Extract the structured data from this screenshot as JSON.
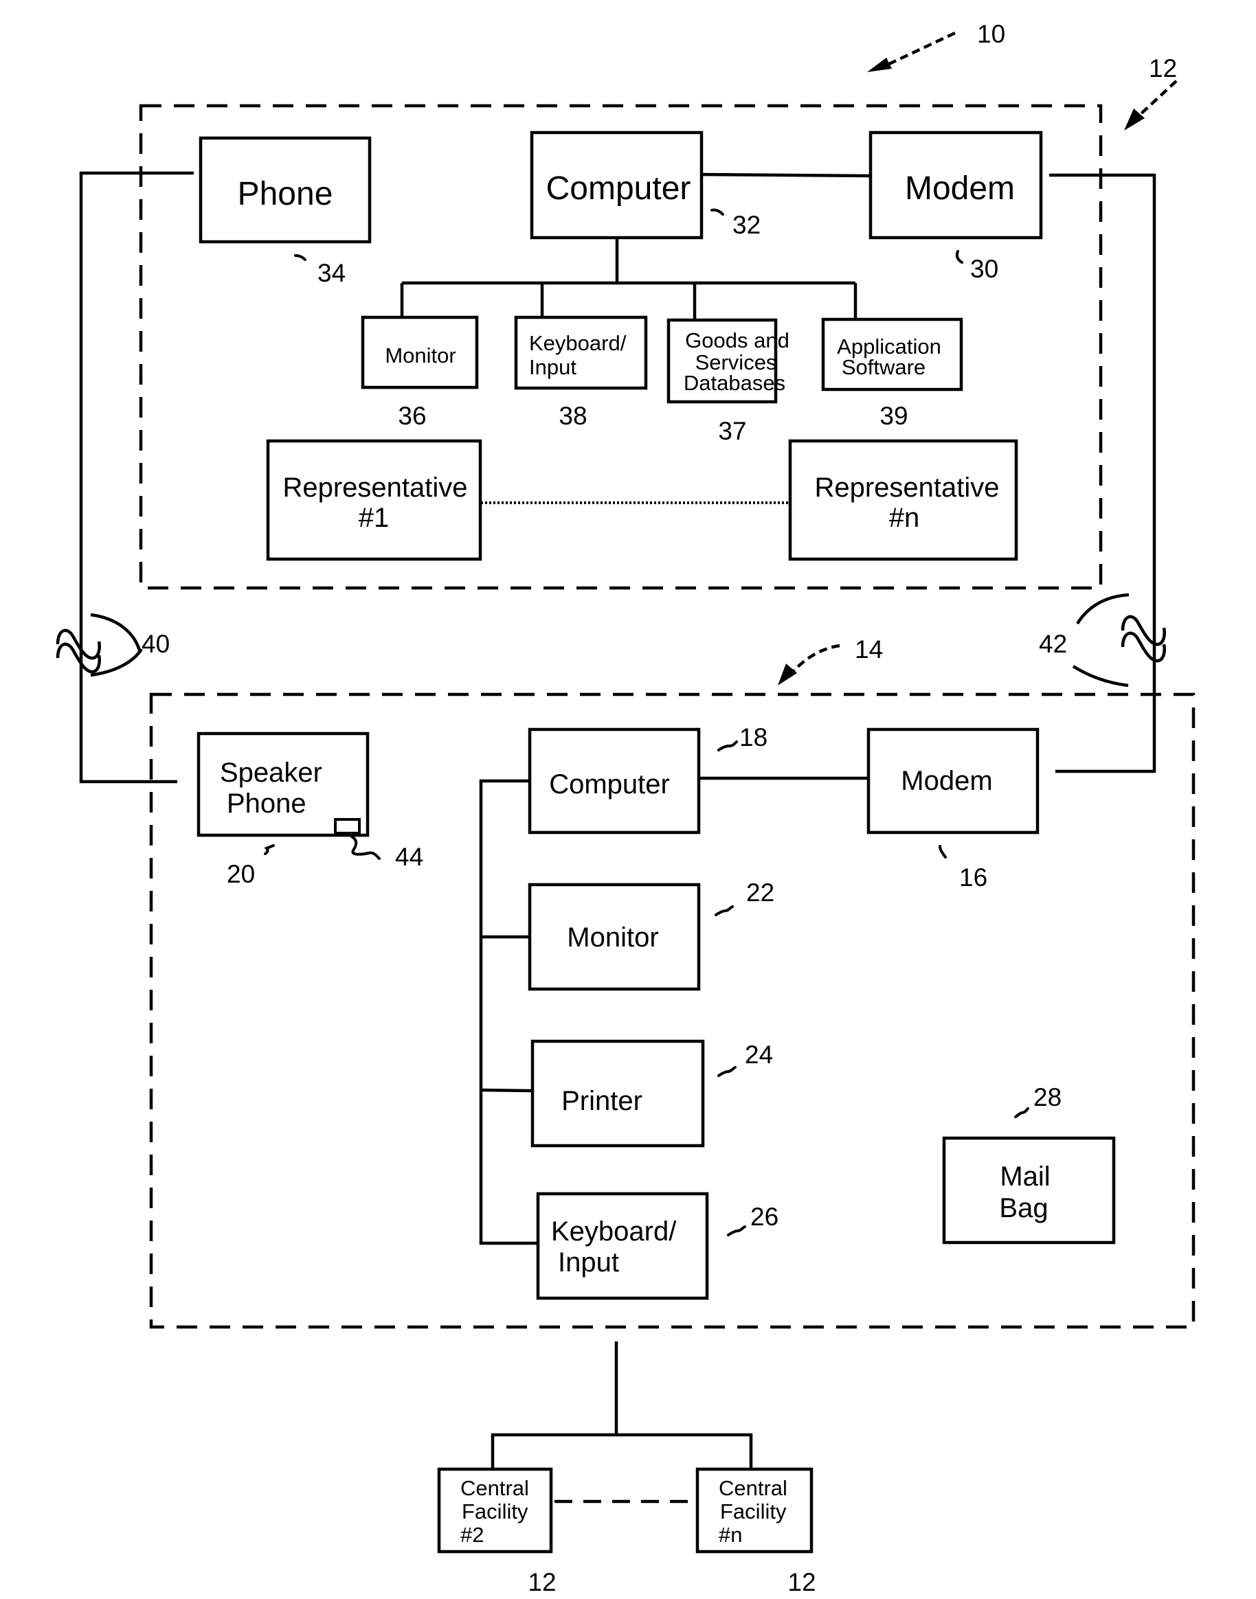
{
  "figure": {
    "reference_numeral": "10",
    "central_facility": {
      "reference": "12",
      "phone": {
        "label": "Phone",
        "ref": "34"
      },
      "computer": {
        "label": "Computer",
        "ref": "32"
      },
      "modem": {
        "label": "Modem",
        "ref": "30"
      },
      "peripherals": [
        {
          "label_lines": [
            "Monitor"
          ],
          "ref": "36"
        },
        {
          "label_lines": [
            "Keyboard/",
            "Input"
          ],
          "ref": "38"
        },
        {
          "label_lines": [
            "Goods and",
            "Services",
            "Databases"
          ],
          "ref": "37"
        },
        {
          "label_lines": [
            "Application",
            "Software"
          ],
          "ref": "39"
        }
      ],
      "representatives": [
        {
          "label_lines": [
            "Representative",
            "#1"
          ]
        },
        {
          "label_lines": [
            "Representative",
            "#n"
          ]
        }
      ]
    },
    "links": {
      "voice_link_ref": "40",
      "data_link_ref": "42"
    },
    "customer_site": {
      "reference": "14",
      "speaker_phone": {
        "label_lines": [
          "Speaker",
          "Phone"
        ],
        "ref": "20",
        "button_ref": "44"
      },
      "computer": {
        "label": "Computer",
        "ref": "18"
      },
      "modem": {
        "label": "Modem",
        "ref": "16"
      },
      "monitor": {
        "label": "Monitor",
        "ref": "22"
      },
      "printer": {
        "label": "Printer",
        "ref": "24"
      },
      "keyboard": {
        "label_lines": [
          "Keyboard/",
          "Input"
        ],
        "ref": "26"
      },
      "mail_bag": {
        "label_lines": [
          "Mail",
          "Bag"
        ],
        "ref": "28"
      }
    },
    "other_facilities": [
      {
        "label_lines": [
          "Central",
          "Facility",
          "#2"
        ],
        "ref": "12"
      },
      {
        "label_lines": [
          "Central",
          "Facility",
          "#n"
        ],
        "ref": "12"
      }
    ]
  }
}
